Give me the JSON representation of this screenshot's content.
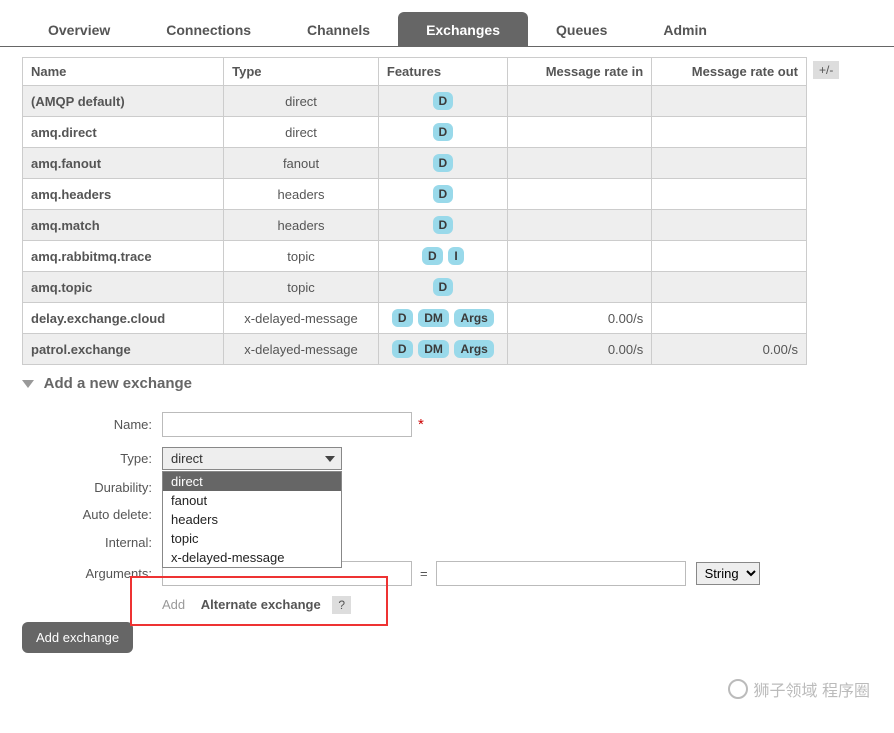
{
  "tabs": {
    "overview": "Overview",
    "connections": "Connections",
    "channels": "Channels",
    "exchanges": "Exchanges",
    "queues": "Queues",
    "admin": "Admin"
  },
  "table": {
    "headers": {
      "name": "Name",
      "type": "Type",
      "features": "Features",
      "rate_in": "Message rate in",
      "rate_out": "Message rate out"
    },
    "rows": [
      {
        "name": "(AMQP default)",
        "type": "direct",
        "features": [
          "D"
        ],
        "rate_in": "",
        "rate_out": ""
      },
      {
        "name": "amq.direct",
        "type": "direct",
        "features": [
          "D"
        ],
        "rate_in": "",
        "rate_out": ""
      },
      {
        "name": "amq.fanout",
        "type": "fanout",
        "features": [
          "D"
        ],
        "rate_in": "",
        "rate_out": ""
      },
      {
        "name": "amq.headers",
        "type": "headers",
        "features": [
          "D"
        ],
        "rate_in": "",
        "rate_out": ""
      },
      {
        "name": "amq.match",
        "type": "headers",
        "features": [
          "D"
        ],
        "rate_in": "",
        "rate_out": ""
      },
      {
        "name": "amq.rabbitmq.trace",
        "type": "topic",
        "features": [
          "D",
          "I"
        ],
        "rate_in": "",
        "rate_out": ""
      },
      {
        "name": "amq.topic",
        "type": "topic",
        "features": [
          "D"
        ],
        "rate_in": "",
        "rate_out": ""
      },
      {
        "name": "delay.exchange.cloud",
        "type": "x-delayed-message",
        "features": [
          "D",
          "DM",
          "Args"
        ],
        "rate_in": "0.00/s",
        "rate_out": ""
      },
      {
        "name": "patrol.exchange",
        "type": "x-delayed-message",
        "features": [
          "D",
          "DM",
          "Args"
        ],
        "rate_in": "0.00/s",
        "rate_out": "0.00/s"
      }
    ],
    "toggle": "+/-"
  },
  "section": {
    "title": "Add a new exchange"
  },
  "form": {
    "labels": {
      "name": "Name:",
      "type": "Type:",
      "durability": "Durability:",
      "auto_delete": "Auto delete:",
      "internal": "Internal:",
      "arguments": "Arguments:"
    },
    "name_value": "",
    "required_mark": "*",
    "type_selected": "direct",
    "type_options": [
      "direct",
      "fanout",
      "headers",
      "topic",
      "x-delayed-message"
    ],
    "help_char": "?",
    "arg_equals": "=",
    "arg_type_selected": "String",
    "add_text": "Add",
    "alt_exchange": "Alternate exchange",
    "submit": "Add exchange"
  },
  "watermark": "狮子领域 程序圈"
}
